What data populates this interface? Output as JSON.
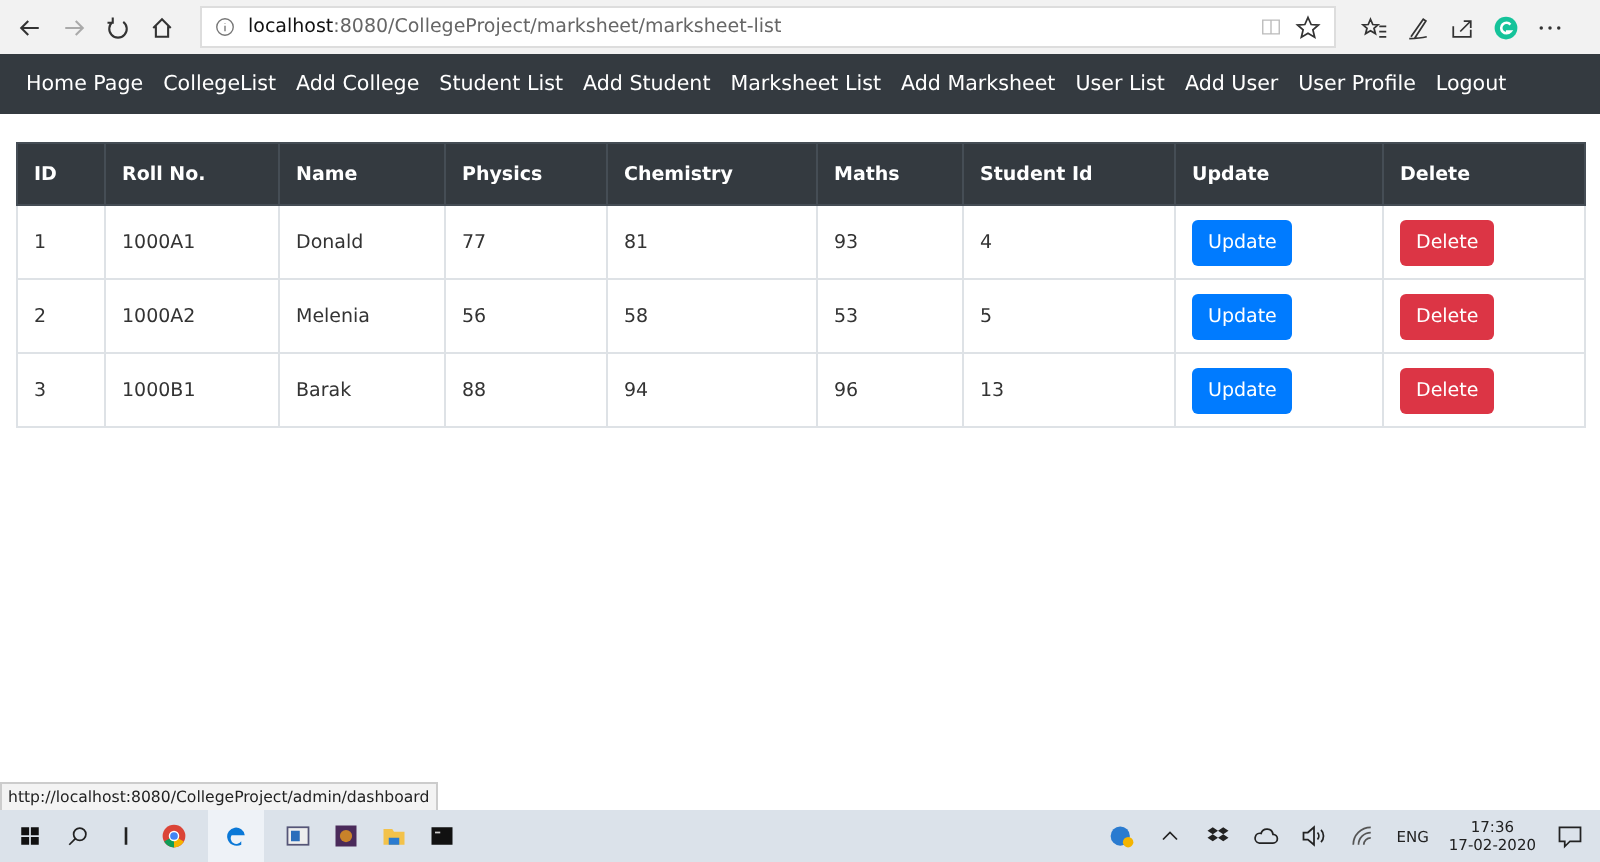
{
  "browser": {
    "url": "**localhost**:8080/CollegeProject/marksheet/marksheet-list"
  },
  "nav": [
    "Home Page",
    "CollegeList",
    "Add College",
    "Student List",
    "Add Student",
    "Marksheet List",
    "Add Marksheet",
    "User List",
    "Add User",
    "User Profile",
    "Logout"
  ],
  "table": {
    "columns": [
      "ID",
      "Roll No.",
      "Name",
      "Physics",
      "Chemistry",
      "Maths",
      "Student Id",
      "Update",
      "Delete"
    ],
    "rows": [
      {
        "cells": [
          "1",
          "1000A1",
          "Donald",
          "77",
          "81",
          "93",
          "4"
        ],
        "update": "Update",
        "delete": "Delete"
      },
      {
        "cells": [
          "2",
          "1000A2",
          "Melenia",
          "56",
          "58",
          "53",
          "5"
        ],
        "update": "Update",
        "delete": "Delete"
      },
      {
        "cells": [
          "3",
          "1000B1",
          "Barak",
          "88",
          "94",
          "96",
          "13"
        ],
        "update": "Update",
        "delete": "Delete"
      }
    ]
  },
  "status_link": "http://localhost:8080/CollegeProject/admin/dashboard",
  "taskbar": {
    "language": "ENG",
    "time": "17:36",
    "date": "17-02-2020"
  }
}
